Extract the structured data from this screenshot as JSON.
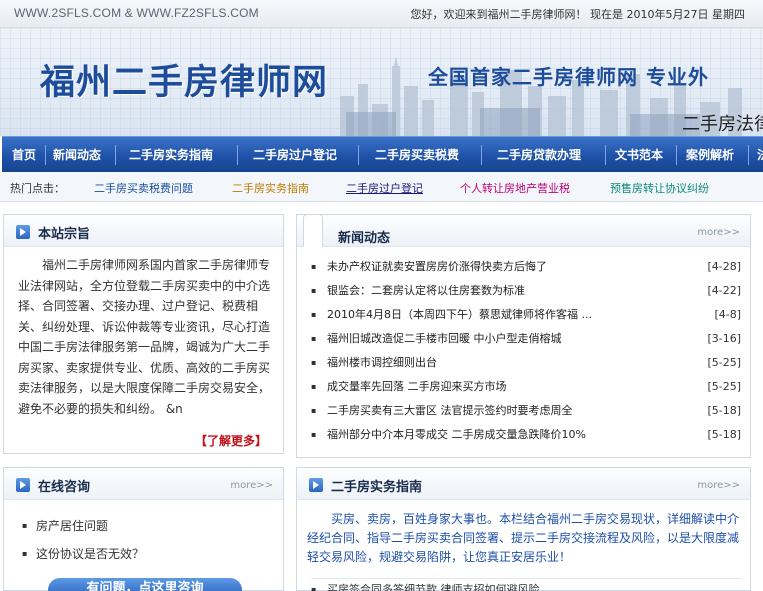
{
  "topbar": {
    "domains": "WWW.2SFLS.COM & WWW.FZ2SFLS.COM",
    "welcome": "您好，欢迎来到福州二手房律师网！  现在是  2010年5月27日  星期四"
  },
  "banner": {
    "logo": "福州二手房律师网",
    "slogan": "全国首家二手房律师网    专业外",
    "sub": "二手房法律"
  },
  "nav": {
    "items": [
      "首页",
      "新闻动态",
      "二手房实务指南",
      "二手房过户登记",
      "二手房买卖税费",
      "二手房贷款办理",
      "文书范本",
      "案例解析",
      "法"
    ]
  },
  "hot": {
    "label": "热门点击：",
    "links": [
      {
        "text": "二手房买卖税费问题",
        "color": "#1b4fa0"
      },
      {
        "text": "二手房实务指南",
        "color": "#c07a00"
      },
      {
        "text": "二手房过户登记",
        "color": "#1a1a7a"
      },
      {
        "text": "个人转让房地产营业税",
        "color": "#c0007a"
      },
      {
        "text": "预售房转让协议纠纷",
        "color": "#0a8a7a"
      }
    ]
  },
  "about": {
    "title": "本站宗旨",
    "body": "福州二手房律师网系国内首家二手房律师专业法律网站，全方位登载二手房买卖中的中介选择、合同签署、交接办理、过户登记、税费相关、纠纷处理、诉讼仲裁等专业资讯，尽心打造中国二手房法律服务第一品牌，竭诚为广大二手房买家、卖家提供专业、优质、高效的二手房买卖法律服务，以是大限度保障二手房交易安全，避免不必要的损失和纠纷。 &n",
    "learn_more": "【了解更多】"
  },
  "news": {
    "title": "新闻动态",
    "more": "more>>",
    "items": [
      {
        "title": "未办产权证就卖安置房房价涨得快卖方后悔了",
        "date": "[4-28]"
      },
      {
        "title": "银监会：二套房认定将以住房套数为标准",
        "date": "[4-22]"
      },
      {
        "title": "2010年4月8日（本周四下午）蔡思斌律师将作客福  ...",
        "date": "[4-8]"
      },
      {
        "title": "福州旧城改造促二手楼市回暖   中小户型走俏榕城",
        "date": "[3-16]"
      },
      {
        "title": "福州楼市调控细则出台",
        "date": "[5-25]"
      },
      {
        "title": "成交量率先回落  二手房迎来买方市场",
        "date": "[5-25]"
      },
      {
        "title": "二手房买卖有三大雷区  法官提示签约时要考虑周全",
        "date": "[5-18]"
      },
      {
        "title": "福州部分中介本月零成交  二手房成交量急跌降价10%",
        "date": "[5-18]"
      }
    ]
  },
  "consult": {
    "title": "在线咨询",
    "more": "more>>",
    "items": [
      "房产居住问题",
      "这份协议是否无效？"
    ],
    "ask_button": "有问题，点这里咨询"
  },
  "guide": {
    "title": "二手房实务指南",
    "more": "more>>",
    "intro": "买房、卖房，百姓身家大事也。本栏结合福州二手房交易现状，详细解读中介经纪合同、指导二手房买卖合同签署、提示二手房交接流程及风险，以是大限度减轻交易风险，规避交易陷阱，让您真正安居乐业！",
    "items": [
      "买房签合同多答细节款  律师支招如何避风险"
    ]
  }
}
